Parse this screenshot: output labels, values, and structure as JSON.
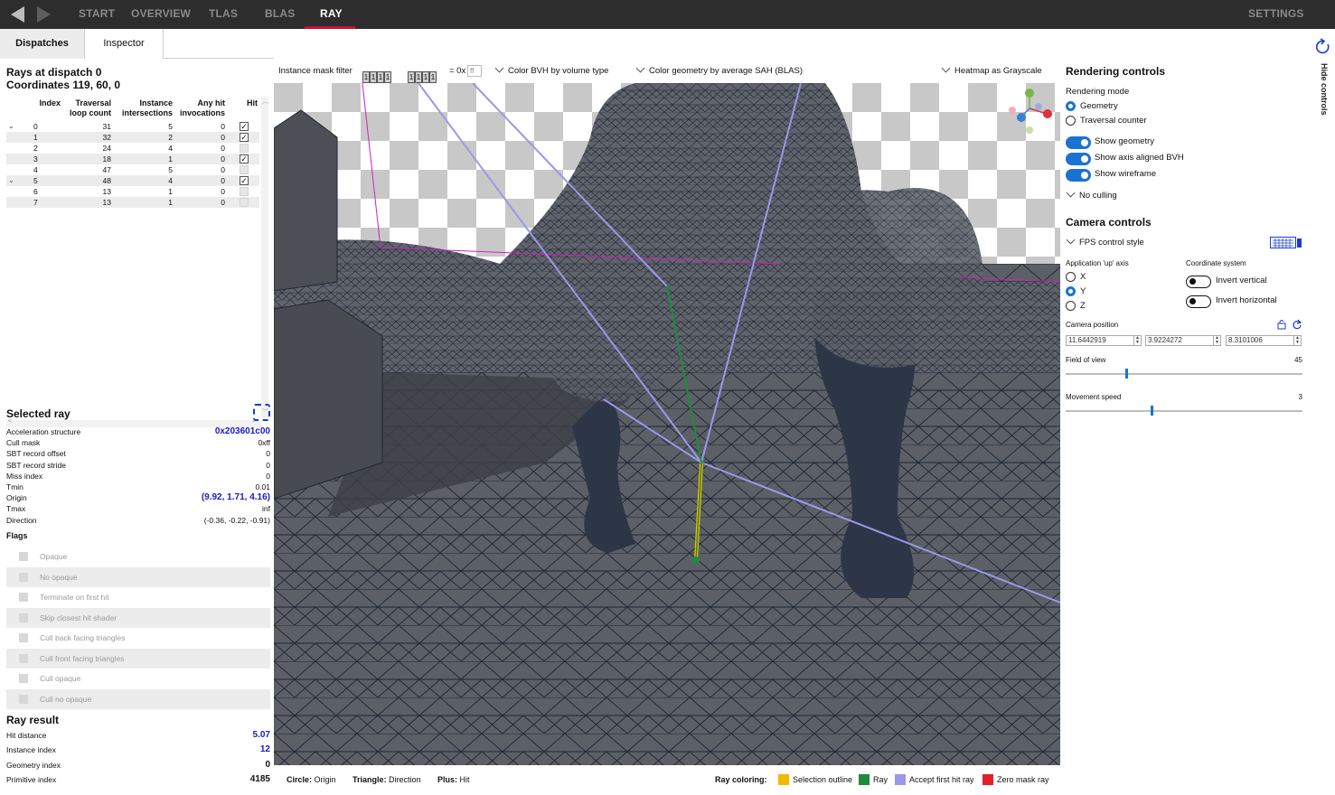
{
  "nav": {
    "tabs": [
      "START",
      "OVERVIEW",
      "TLAS",
      "BLAS",
      "RAY"
    ],
    "active_tab": "RAY",
    "settings": "SETTINGS"
  },
  "subtabs": [
    "Dispatches",
    "Inspector"
  ],
  "rays": {
    "title": "Rays at dispatch 0",
    "coords": "Coordinates 119, 60, 0",
    "headers": {
      "index": "Index",
      "traversal": [
        "Traversal",
        "loop count"
      ],
      "instance": [
        "Instance",
        "intersections"
      ],
      "anyhit": [
        "Any hit",
        "invocations"
      ],
      "hit": "Hit"
    },
    "rows": [
      {
        "expander": "⌄",
        "index": "0",
        "loop": "31",
        "inst": "5",
        "any": "0",
        "hit": true
      },
      {
        "expander": "",
        "index": "1",
        "loop": "32",
        "inst": "2",
        "any": "0",
        "hit": true
      },
      {
        "expander": "",
        "index": "2",
        "loop": "24",
        "inst": "4",
        "any": "0",
        "hit": false
      },
      {
        "expander": "",
        "index": "3",
        "loop": "18",
        "inst": "1",
        "any": "0",
        "hit": true
      },
      {
        "expander": "",
        "index": "4",
        "loop": "47",
        "inst": "5",
        "any": "0",
        "hit": false
      },
      {
        "expander": "⌄",
        "index": "5",
        "loop": "48",
        "inst": "4",
        "any": "0",
        "hit": true
      },
      {
        "expander": "",
        "index": "6",
        "loop": "13",
        "inst": "1",
        "any": "0",
        "hit": false
      },
      {
        "expander": "",
        "index": "7",
        "loop": "13",
        "inst": "1",
        "any": "0",
        "hit": false
      }
    ]
  },
  "selected_ray": {
    "title": "Selected ray",
    "fields": [
      {
        "k": "Acceleration structure",
        "v": "0x203601c00",
        "style": "blue"
      },
      {
        "k": "Cull mask",
        "v": "0xff",
        "style": ""
      },
      {
        "k": "SBT record offset",
        "v": "0",
        "style": ""
      },
      {
        "k": "SBT record stride",
        "v": "0",
        "style": ""
      },
      {
        "k": "Miss index",
        "v": "0",
        "style": ""
      },
      {
        "k": "Tmin",
        "v": "0.01",
        "style": ""
      },
      {
        "k": "Origin",
        "v": "(9.92, 1.71, 4.16)",
        "style": "blue"
      },
      {
        "k": "Tmax",
        "v": "inf",
        "style": ""
      },
      {
        "k": "Direction",
        "v": "(-0.36, -0.22, -0.91)",
        "style": ""
      }
    ],
    "flags_title": "Flags",
    "flags": [
      "Opaque",
      "No opaque",
      "Terminate on first hit",
      "Skip closest hit shader",
      "Cull back facing triangles",
      "Cull front facing triangles",
      "Cull opaque",
      "Cull no opaque"
    ]
  },
  "ray_result": {
    "title": "Ray result",
    "fields": [
      {
        "k": "Hit distance",
        "v": "5.07",
        "style": "blue"
      },
      {
        "k": "Instance index",
        "v": "12",
        "style": "blue"
      },
      {
        "k": "Geometry index",
        "v": "0",
        "style": "bold"
      },
      {
        "k": "Primitive index",
        "v": "4185",
        "style": "bold"
      }
    ]
  },
  "viewport_bar": {
    "mask_label": "Instance mask filter",
    "bits_a": [
      "1",
      "1",
      "1",
      "1"
    ],
    "bits_b": [
      "1",
      "1",
      "1",
      "1"
    ],
    "mask_eq": "= 0x",
    "mask_hex": "ff",
    "color_bvh": "Color BVH by volume type",
    "color_geometry": "Color geometry by average SAH (BLAS)",
    "heatmap": "Heatmap as Grayscale"
  },
  "legend": {
    "circle_label": "Circle:",
    "circle_value": "Origin",
    "triangle_label": "Triangle:",
    "triangle_value": "Direction",
    "plus_label": "Plus:",
    "plus_value": "Hit",
    "coloring_label": "Ray coloring:",
    "items": [
      {
        "label": "Selection outline",
        "color": "#f5b800"
      },
      {
        "label": "Ray",
        "color": "#1e8c3a"
      },
      {
        "label": "Accept first hit ray",
        "color": "#9a98e8"
      },
      {
        "label": "Zero mask ray",
        "color": "#e0202c"
      }
    ]
  },
  "rendering": {
    "title": "Rendering controls",
    "mode_label": "Rendering mode",
    "modes": [
      "Geometry",
      "Traversal counter"
    ],
    "toggles": [
      "Show geometry",
      "Show axis aligned BVH",
      "Show wireframe"
    ],
    "culling": "No culling"
  },
  "camera": {
    "title": "Camera controls",
    "control_style": "FPS control style",
    "up_axis_label": "Application 'up' axis",
    "axes": [
      "X",
      "Y",
      "Z"
    ],
    "coord_label": "Coordinate system",
    "invert_vertical": "Invert vertical",
    "invert_horizontal": "Invert horizontal",
    "position_label": "Camera position",
    "position": [
      "11.6442919",
      "3.9224272",
      "8.3101006"
    ],
    "fov_label": "Field of view",
    "fov_value": "45",
    "fov_fraction": 0.25,
    "speed_label": "Movement speed",
    "speed_value": "3",
    "speed_fraction": 0.36
  },
  "hide_controls": "Hide controls",
  "colors": {
    "accent": "#1a73d1",
    "active_tab_underline": "#c8102e",
    "topbar": "#2d2d2d",
    "geometry": "#5b5e66",
    "wireframe": "#1f2a3a"
  }
}
